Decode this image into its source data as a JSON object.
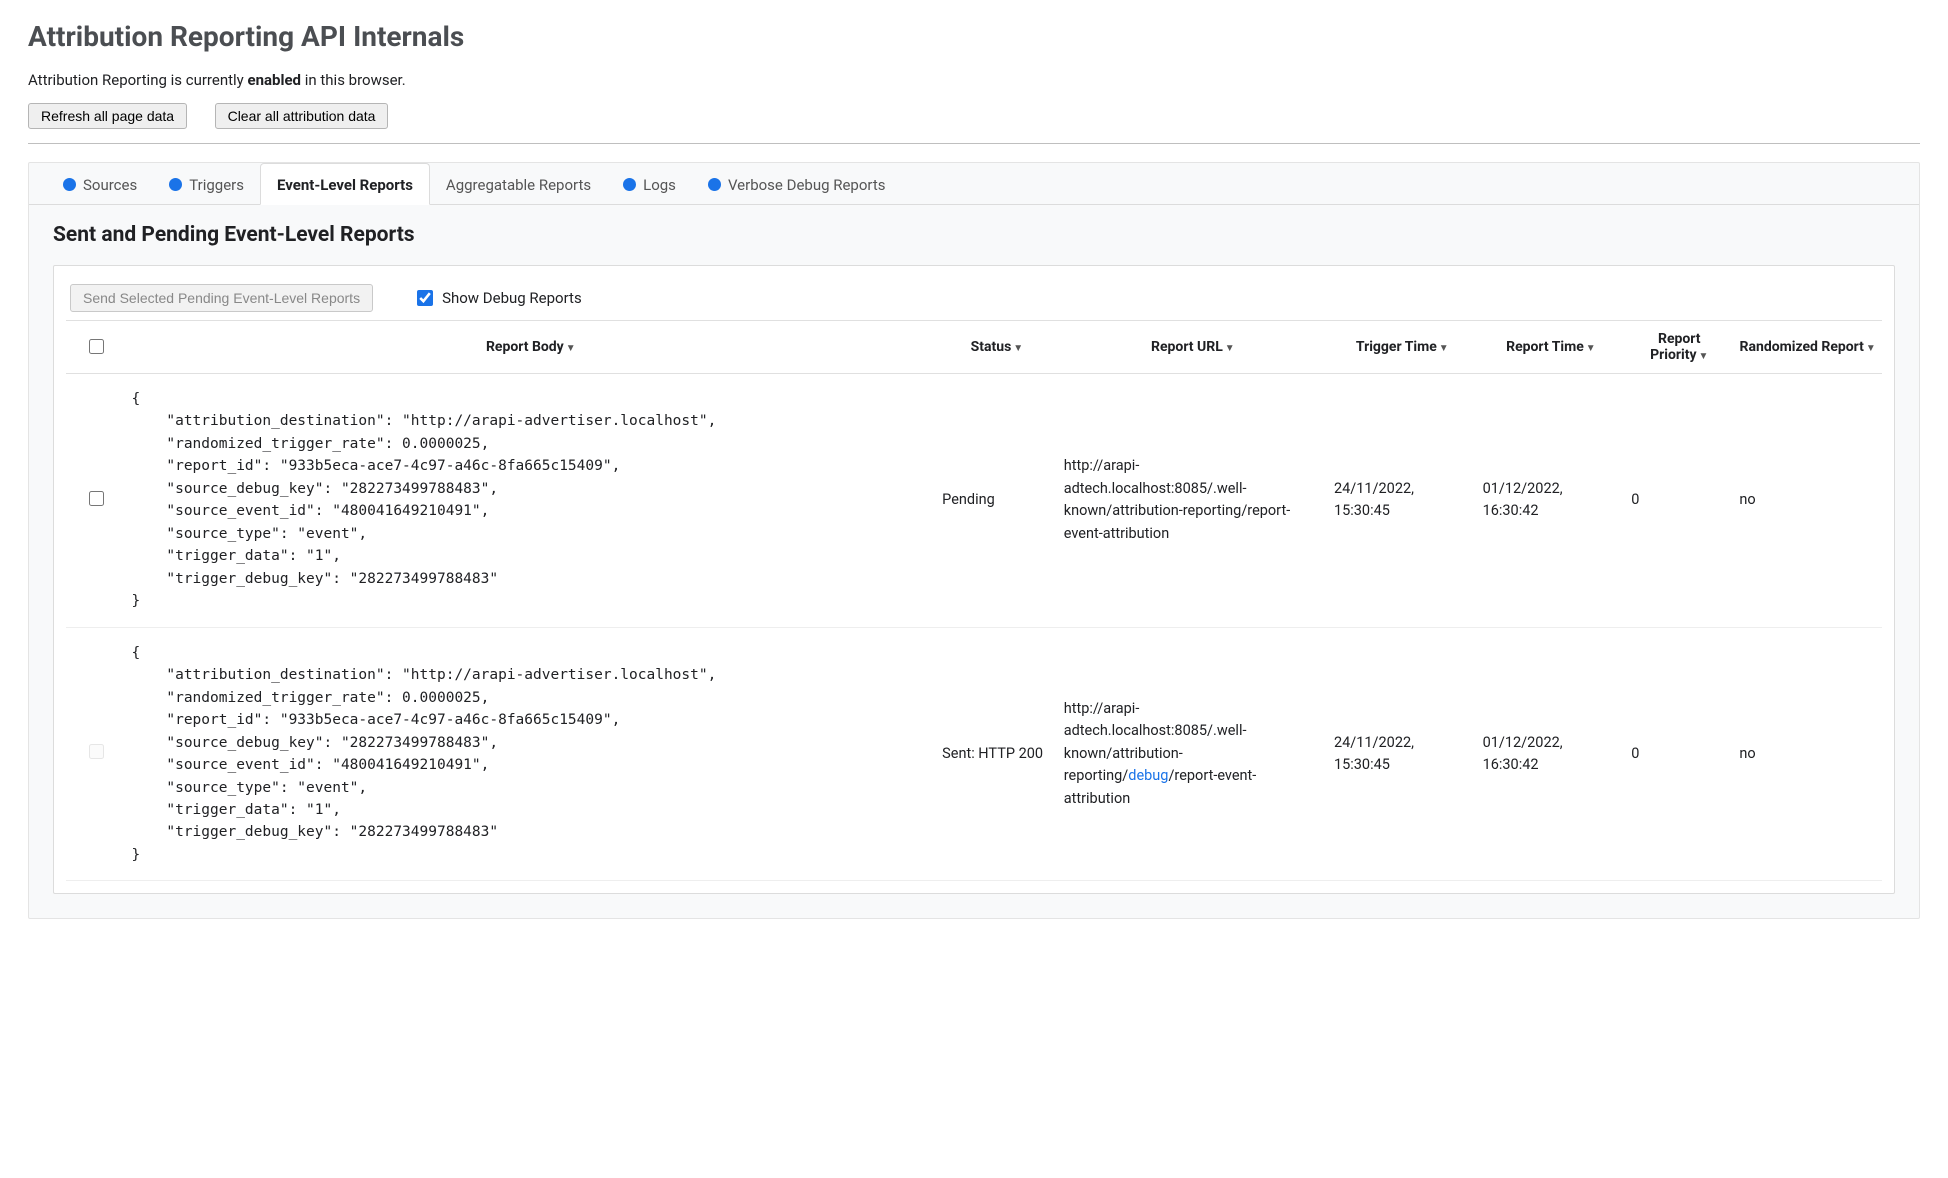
{
  "header": {
    "title": "Attribution Reporting API Internals",
    "status_prefix": "Attribution Reporting is currently ",
    "status_state": "enabled",
    "status_suffix": " in this browser.",
    "refresh_btn": "Refresh all page data",
    "clear_btn": "Clear all attribution data"
  },
  "tabs": [
    {
      "label": "Sources",
      "dot": true,
      "active": false
    },
    {
      "label": "Triggers",
      "dot": true,
      "active": false
    },
    {
      "label": "Event-Level Reports",
      "dot": false,
      "active": true
    },
    {
      "label": "Aggregatable Reports",
      "dot": false,
      "active": false
    },
    {
      "label": "Logs",
      "dot": true,
      "active": false
    },
    {
      "label": "Verbose Debug Reports",
      "dot": true,
      "active": false
    }
  ],
  "section_title": "Sent and Pending Event-Level Reports",
  "toolbar": {
    "send_btn": "Send Selected Pending Event-Level Reports",
    "show_debug_label": "Show Debug Reports",
    "show_debug_checked": true
  },
  "columns": {
    "body": "Report Body",
    "status": "Status",
    "url": "Report URL",
    "trigger_time": "Trigger Time",
    "report_time": "Report Time",
    "priority": "Report Priority",
    "randomized": "Randomized Report"
  },
  "rows": [
    {
      "checkable": true,
      "body": {
        "attribution_destination": "http://arapi-advertiser.localhost",
        "randomized_trigger_rate": 2.5e-06,
        "report_id": "933b5eca-ace7-4c97-a46c-8fa665c15409",
        "source_debug_key": "282273499788483",
        "source_event_id": "480041649210491",
        "source_type": "event",
        "trigger_data": "1",
        "trigger_debug_key": "282273499788483"
      },
      "status": "Pending",
      "url_pre": "http://arapi-adtech.localhost:8085/.well-known/attribution-reporting/report-event-attribution",
      "url_debug": "",
      "url_post": "",
      "trigger_time": "24/11/2022, 15:30:45",
      "report_time": "01/12/2022, 16:30:42",
      "priority": "0",
      "randomized": "no"
    },
    {
      "checkable": false,
      "body": {
        "attribution_destination": "http://arapi-advertiser.localhost",
        "randomized_trigger_rate": 2.5e-06,
        "report_id": "933b5eca-ace7-4c97-a46c-8fa665c15409",
        "source_debug_key": "282273499788483",
        "source_event_id": "480041649210491",
        "source_type": "event",
        "trigger_data": "1",
        "trigger_debug_key": "282273499788483"
      },
      "status": "Sent: HTTP 200",
      "url_pre": "http://arapi-adtech.localhost:8085/.well-known/attribution-reporting/",
      "url_debug": "debug",
      "url_post": "/report-event-attribution",
      "trigger_time": "24/11/2022, 15:30:45",
      "report_time": "01/12/2022, 16:30:42",
      "priority": "0",
      "randomized": "no"
    }
  ]
}
